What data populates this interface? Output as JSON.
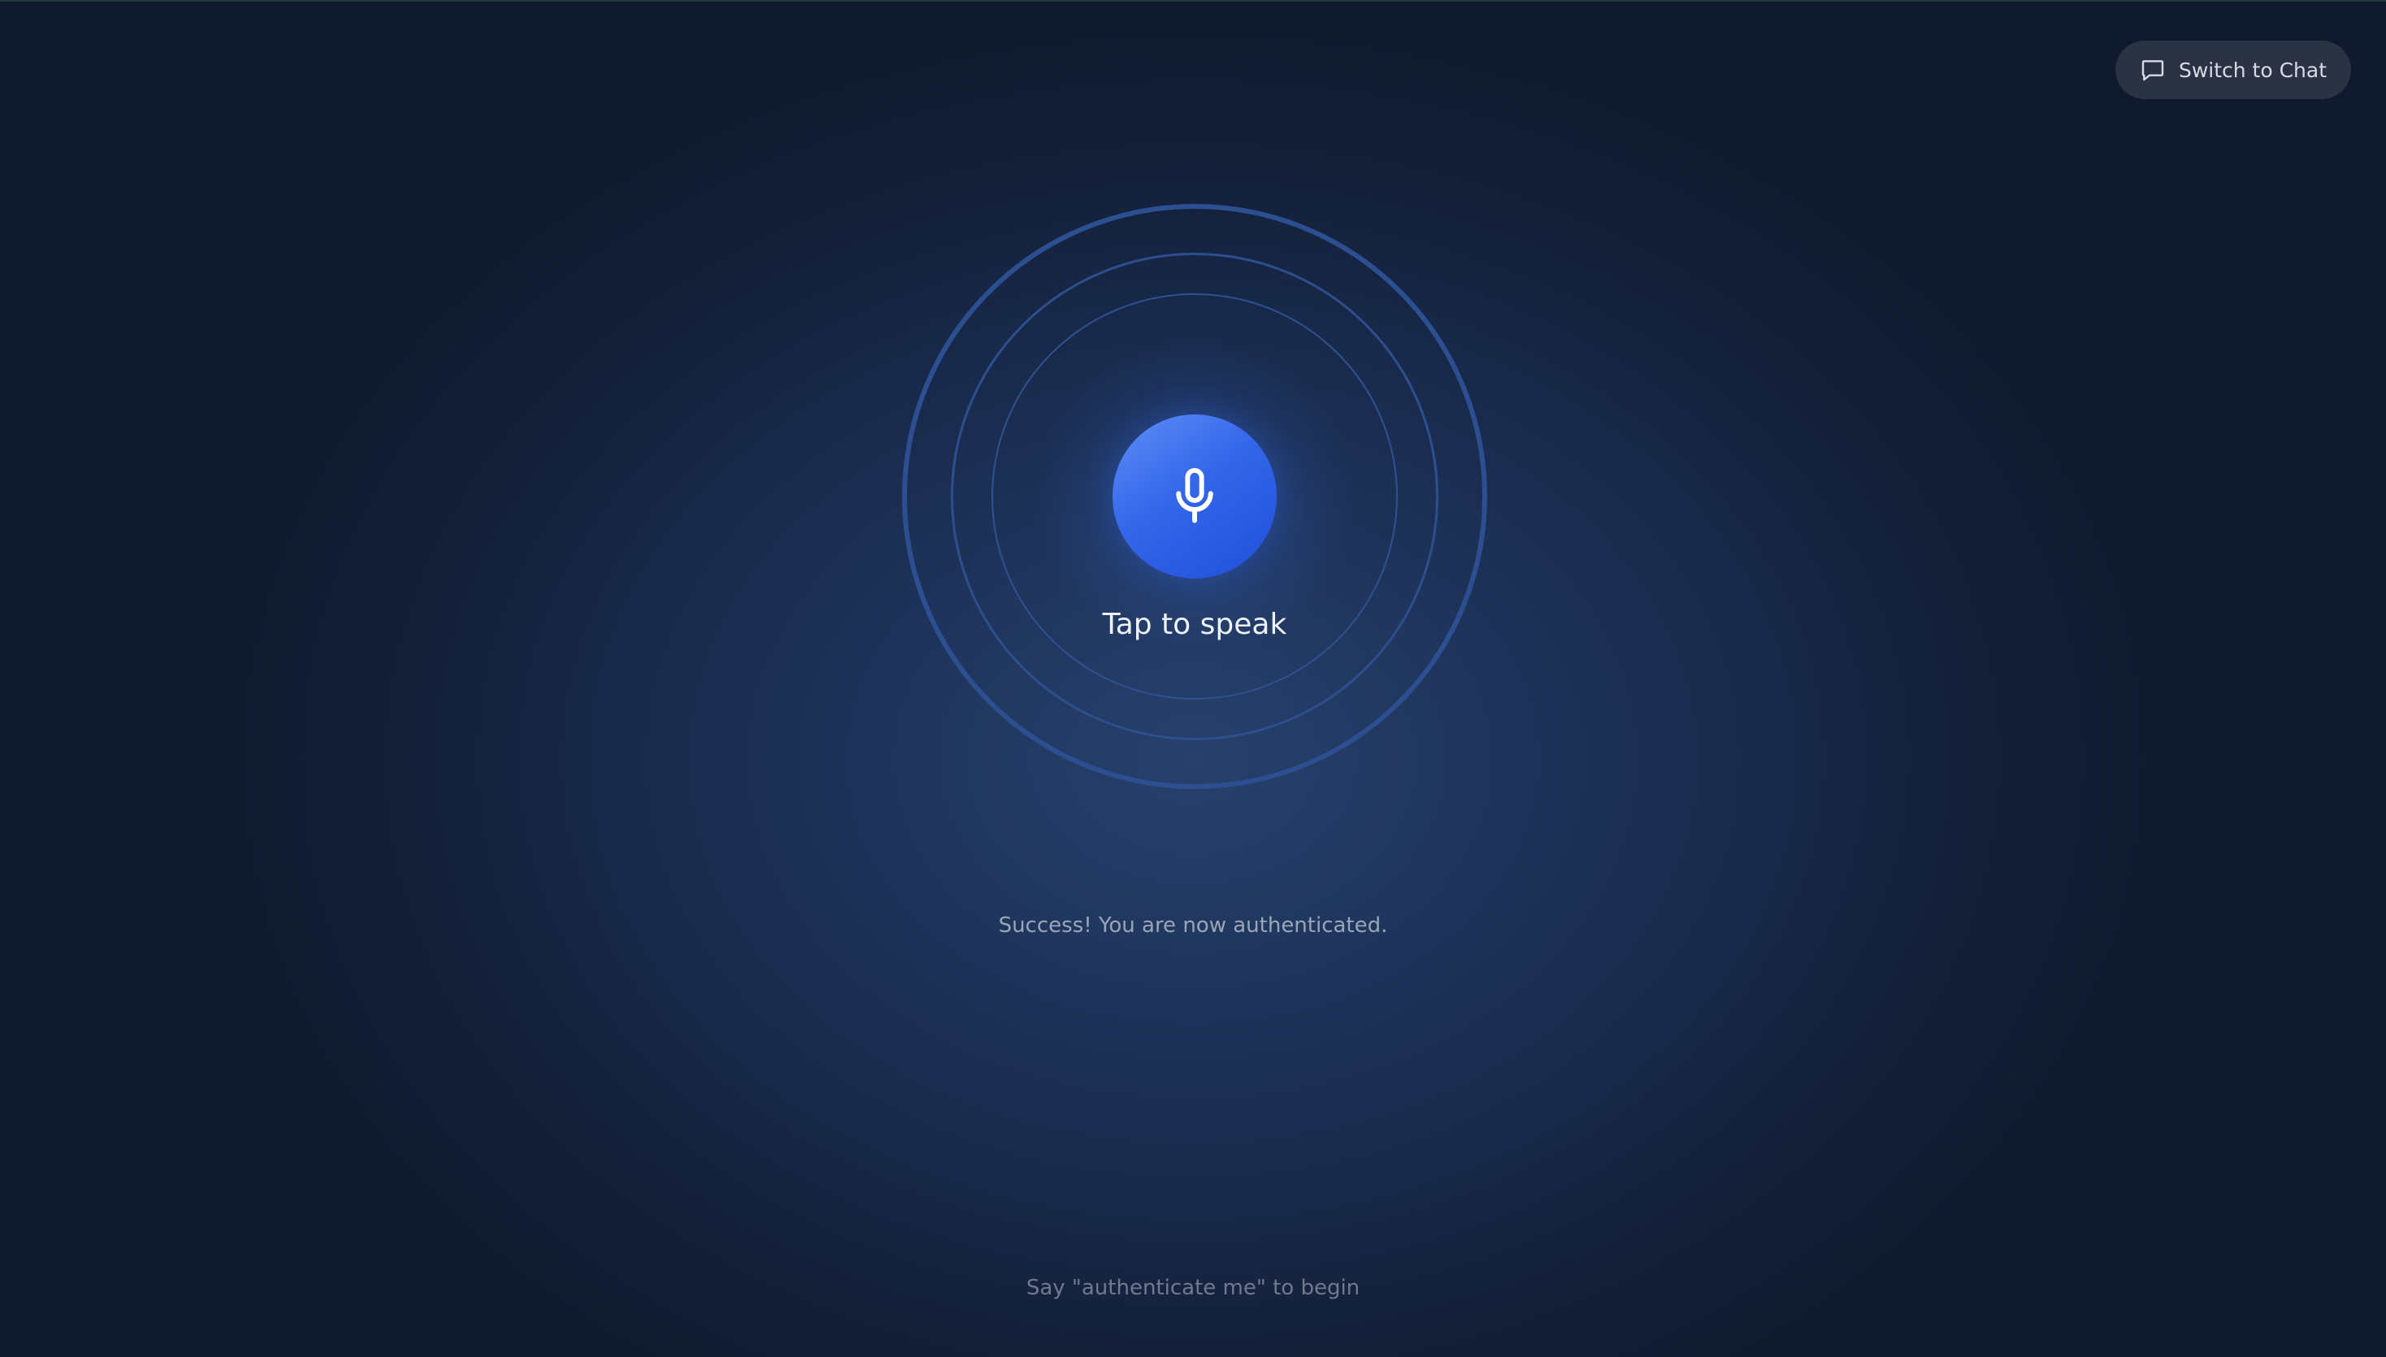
{
  "header": {
    "switch_button_label": "Switch to Chat",
    "switch_button_icon": "chat-bubble-icon"
  },
  "voice": {
    "mic_icon": "microphone-icon",
    "tap_label": "Tap to speak",
    "status_message": "Success! You are now authenticated.",
    "hint": "Say \"authenticate me\" to begin"
  },
  "colors": {
    "background": "#101a2f",
    "accent": "#2f63e6",
    "ring": "#2c4f91",
    "button_bg": "#2a3244"
  }
}
